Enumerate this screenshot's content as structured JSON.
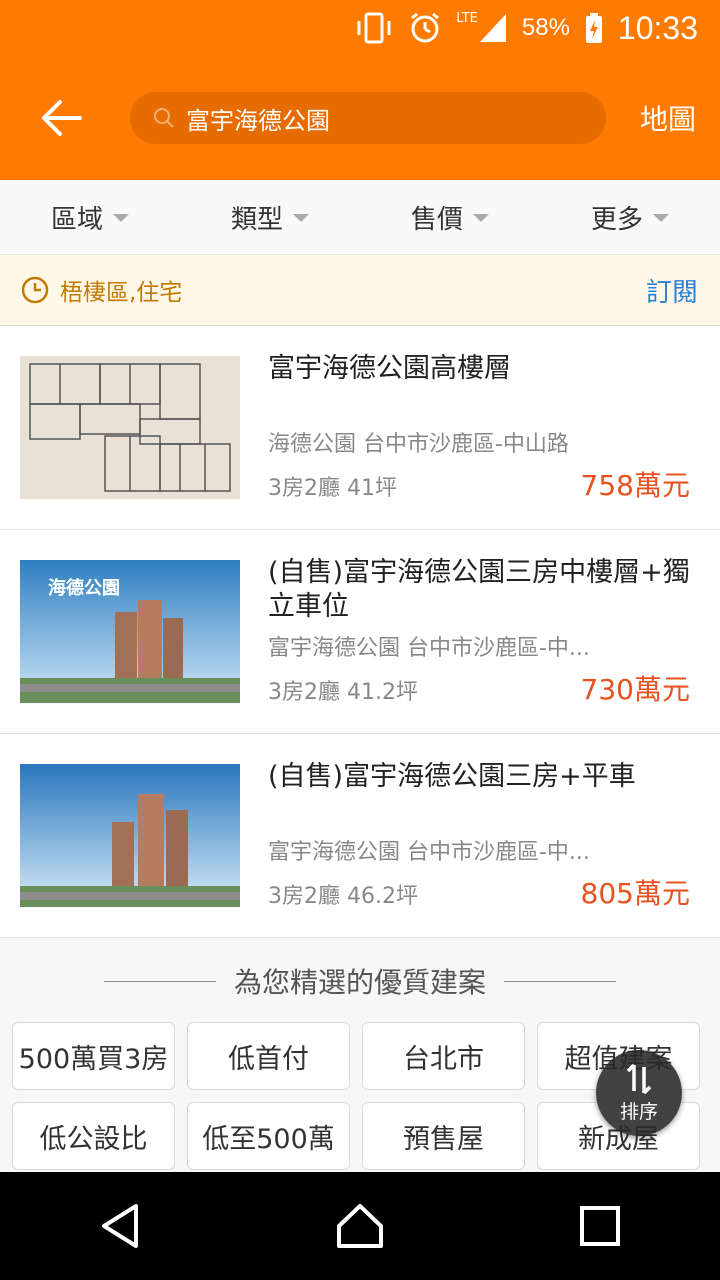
{
  "status": {
    "battery": "58%",
    "time": "10:33",
    "network": "LTE"
  },
  "header": {
    "search_text": "富宇海德公園",
    "map_label": "地圖"
  },
  "filters": [
    {
      "label": "區域"
    },
    {
      "label": "類型"
    },
    {
      "label": "售價"
    },
    {
      "label": "更多"
    }
  ],
  "criteria": {
    "text": "梧棲區,住宅",
    "subscribe_label": "訂閱"
  },
  "listings": [
    {
      "title": "富宇海德公園高樓層",
      "address": "海德公園 台中市沙鹿區-中山路",
      "spec": "3房2廳 41坪",
      "price": "758萬元",
      "thumb": "floorplan"
    },
    {
      "title": "(自售)富宇海德公園三房中樓層+獨立車位",
      "address": "富宇海德公園 台中市沙鹿區-中...",
      "spec": "3房2廳 41.2坪",
      "price": "730萬元",
      "thumb": "building",
      "thumb_text": "海德公園"
    },
    {
      "title": "(自售)富宇海德公園三房+平車",
      "address": "富宇海德公園 台中市沙鹿區-中...",
      "spec": "3房2廳 46.2坪",
      "price": "805萬元",
      "thumb": "building"
    }
  ],
  "featured": {
    "heading": "為您精選的優質建案",
    "tags": [
      "500萬買3房",
      "低首付",
      "台北市",
      "超值建案",
      "低公設比",
      "低至500萬",
      "預售屋",
      "新成屋"
    ]
  },
  "fab": {
    "label": "排序"
  },
  "colors": {
    "brand": "#ff7a00",
    "price": "#e8521e",
    "link": "#2a7fd1"
  }
}
